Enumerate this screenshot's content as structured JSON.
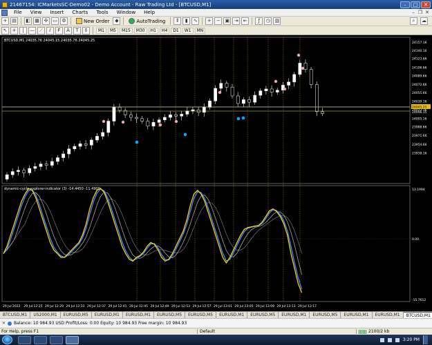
{
  "window": {
    "title": "21467154: ICMarketsSC-Demo02 - Demo Account - Raw Trading Ltd - [BTCUSD,M1]"
  },
  "menu": {
    "items": [
      "File",
      "View",
      "Insert",
      "Charts",
      "Tools",
      "Window",
      "Help"
    ]
  },
  "toolbar": {
    "new_order": "New Order",
    "autotrading": "AutoTrading"
  },
  "timeframes": [
    "M1",
    "M5",
    "M15",
    "M30",
    "H1",
    "H4",
    "D1",
    "W1",
    "MN"
  ],
  "chart": {
    "header": "BTCUSD,M1  24035.76 24045.15 24035.76 24045.25",
    "price_ticks": [
      {
        "value": "24157.16",
        "y": 0.033
      },
      {
        "value": "24140.16",
        "y": 0.089
      },
      {
        "value": "24123.66",
        "y": 0.145
      },
      {
        "value": "24106.66",
        "y": 0.205
      },
      {
        "value": "24089.66",
        "y": 0.262
      },
      {
        "value": "24072.66",
        "y": 0.32
      },
      {
        "value": "24055.66",
        "y": 0.378
      },
      {
        "value": "24039.16",
        "y": 0.436
      },
      {
        "value": "24022.16",
        "y": 0.496
      },
      {
        "value": "24005.16",
        "y": 0.554
      },
      {
        "value": "23988.66",
        "y": 0.612
      },
      {
        "value": "23971.66",
        "y": 0.67
      },
      {
        "value": "23954.66",
        "y": 0.73
      },
      {
        "value": "23938.16",
        "y": 0.789
      }
    ],
    "current_price_label": "24045.25",
    "current_price_label2": "24046.15",
    "indicator_header": "dynamic-cycle-explorer-indicator (3) -14.4450 -11.4900",
    "indicator_ticks": [
      "13.1994",
      "0.00",
      "-15.7612"
    ],
    "time_labels": [
      "29 Jul 2022",
      "29 Jul 12:25",
      "29 Jul 12:29",
      "29 Jul 12:33",
      "29 Jul 12:37",
      "29 Jul 12:41",
      "29 Jul 12:45",
      "29 Jul 12:49",
      "29 Jul 12:53",
      "29 Jul 12:57",
      "29 Jul 13:01",
      "29 Jul 13:05",
      "29 Jul 13:09",
      "29 Jul 13:13",
      "29 Jul 13:17"
    ]
  },
  "tabs": [
    "BTCUSD,M1",
    "US2000,M1",
    "EURUSD,M5",
    "EURUSD,M1",
    "EURUSD,M1",
    "EURUSD,M5",
    "EURUSD,M5",
    "EURUSD,M1",
    "EURUSD,M5",
    "EURUSD,M1",
    "EURUSD,M5",
    "EURUSD,M1",
    "EURUSD,M1",
    "BTCUSD,M1"
  ],
  "terminal": {
    "account_line": "Balance: 10 984.93 USD  Profit/Loss: 0.00  Equity: 10 984.93  Free margin: 10 984.93"
  },
  "status": {
    "help": "For Help, press F1",
    "profile": "Default",
    "traffic": "2100/2 kb"
  },
  "taskbar": {
    "clock": "3:20 PM"
  },
  "colors": {
    "bull": "#ffffff",
    "bear": "#000000",
    "grid_line": "#c8a020",
    "price_line": "#ddd8a0",
    "osc_fast": "#ffd100",
    "osc_slow": "#3f8fff",
    "osc_ma1": "#bbbbbb",
    "osc_ma2": "#777777"
  }
}
